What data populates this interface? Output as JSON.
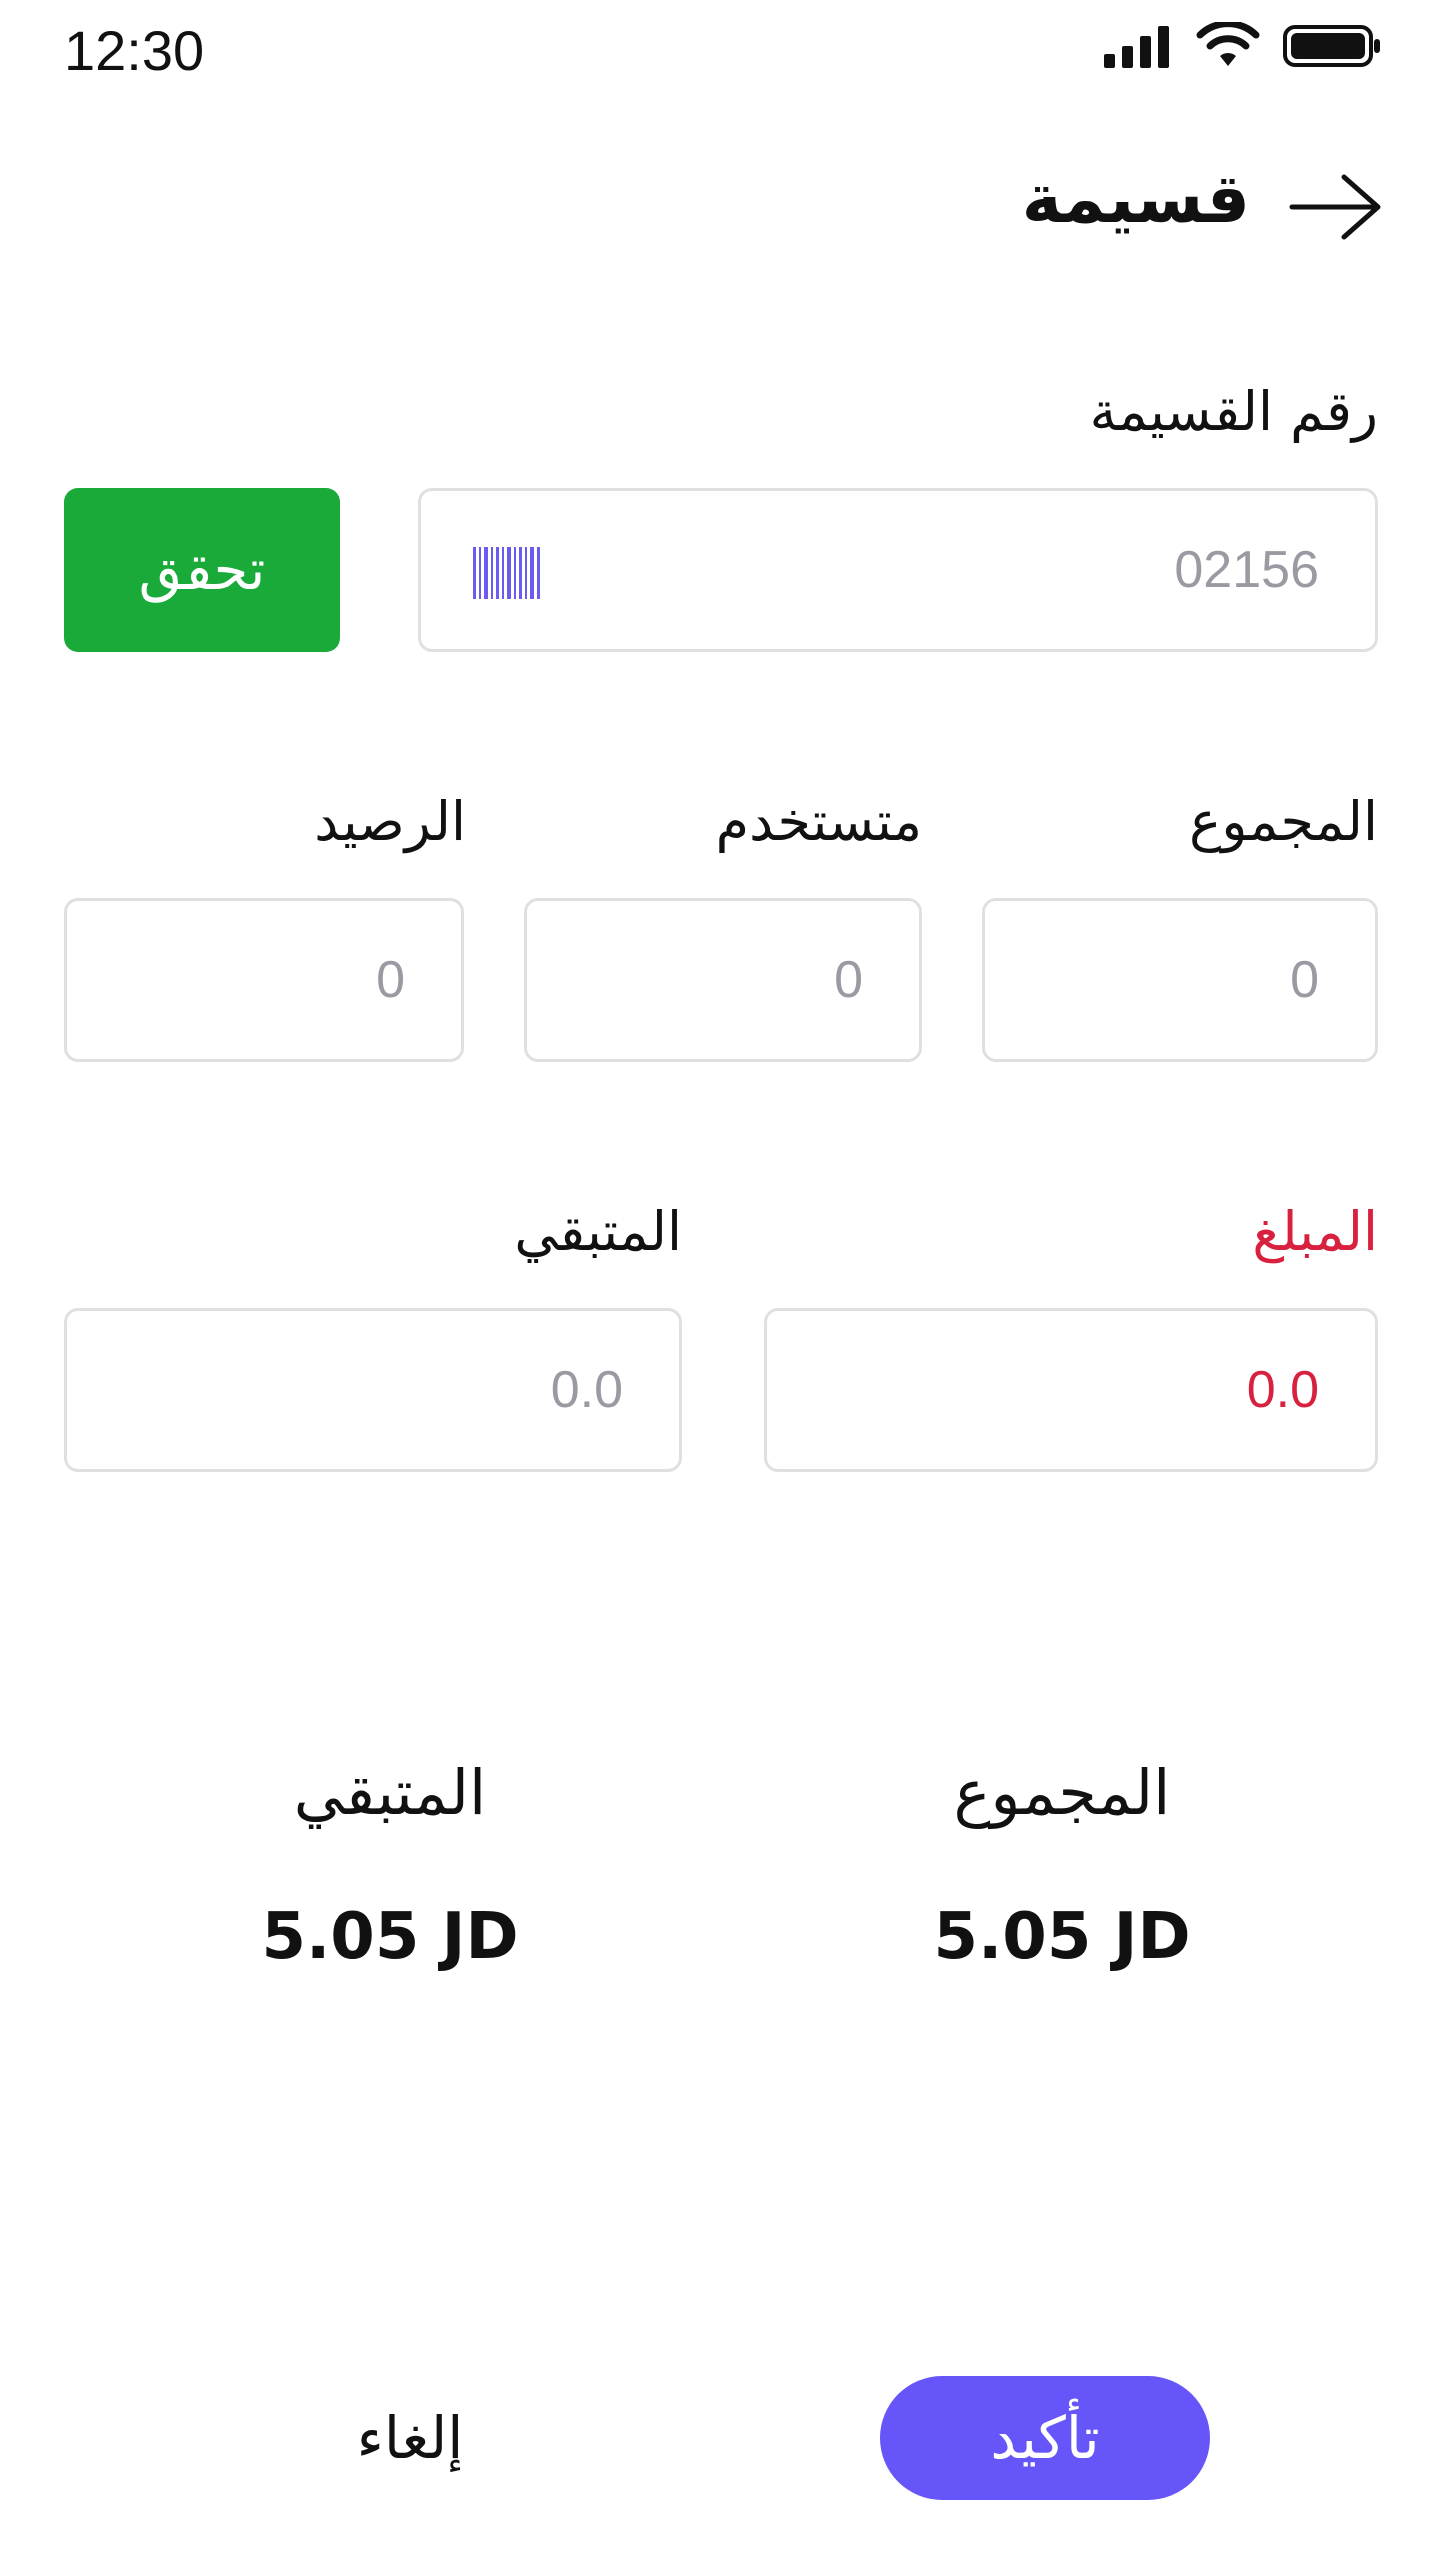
{
  "status_bar": {
    "time": "12:30"
  },
  "header": {
    "title": "قسيمة"
  },
  "voucher": {
    "label": "رقم القسيمة",
    "placeholder": "02156",
    "verify_label": "تحقق"
  },
  "balances": {
    "total_label": "المجموع",
    "total_value": "0",
    "used_label": "متستخدم",
    "used_value": "0",
    "balance_label": "الرصيد",
    "balance_value": "0"
  },
  "amounts": {
    "amount_label": "المبلغ",
    "amount_value": "0.0",
    "remaining_label": "المتبقي",
    "remaining_value": "0.0"
  },
  "summary": {
    "total_label": "المجموع",
    "total_value": "5.05 JD",
    "remaining_label": "المتبقي",
    "remaining_value": "5.05 JD"
  },
  "actions": {
    "confirm_label": "تأكيد",
    "cancel_label": "إلغاء"
  },
  "colors": {
    "verify_green": "#1aaa3a",
    "confirm_purple": "#6655f8",
    "amount_red": "#d8203f",
    "barcode_purple": "#6a5cf0"
  }
}
